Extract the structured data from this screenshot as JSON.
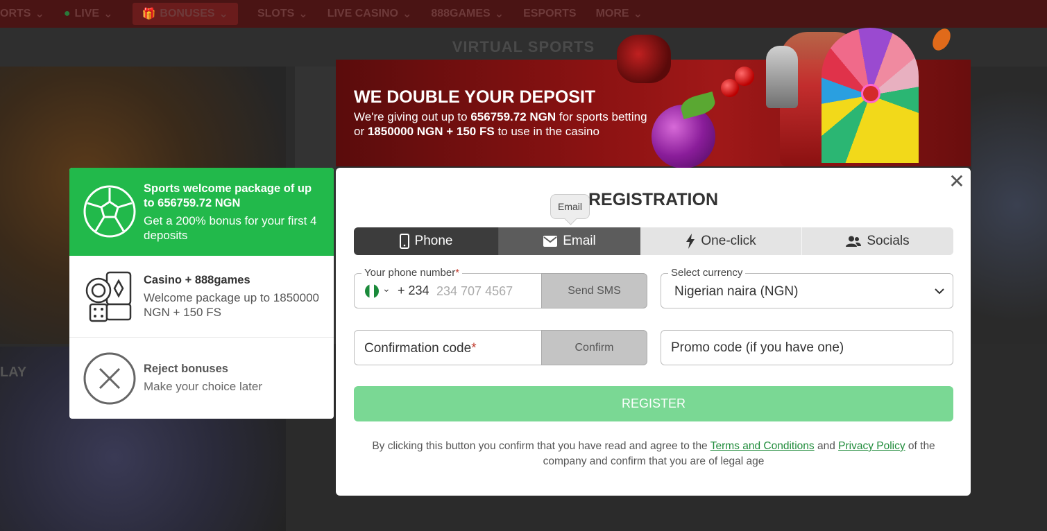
{
  "topnav": {
    "items": [
      "ORTS",
      "LIVE",
      "BONUSES",
      "SLOTS",
      "LIVE CASINO",
      "888GAMES",
      "ESPORTS",
      "MORE"
    ]
  },
  "subbar": {
    "title": "VIRTUAL SPORTS"
  },
  "background": {
    "left_label": "LAY"
  },
  "banner": {
    "title": "WE DOUBLE YOUR DEPOSIT",
    "line1_pre": "We're giving out up to ",
    "line1_bold": "656759.72 NGN",
    "line1_post": " for sports betting",
    "line2_pre": "or ",
    "line2_bold": "1850000 NGN + 150 FS",
    "line2_post": " to use in the casino"
  },
  "bonuses": {
    "sports": {
      "title": "Sports welcome package of up to 656759.72 NGN",
      "desc": "Get a 200% bonus for your first 4 deposits",
      "icon": "soccer-ball-icon"
    },
    "casino": {
      "title": "Casino + 888games",
      "desc": "Welcome package up to 1850000 NGN + 150 FS",
      "icon": "casino-chips-icon"
    },
    "reject": {
      "title": "Reject bonuses",
      "desc": "Make your choice later",
      "icon": "close-circle-icon"
    }
  },
  "modal": {
    "title": "REGISTRATION",
    "tooltip": "Email",
    "tabs": [
      {
        "label": "Phone",
        "icon": "phone-icon"
      },
      {
        "label": "Email",
        "icon": "mail-icon"
      },
      {
        "label": "One-click",
        "icon": "lightning-icon"
      },
      {
        "label": "Socials",
        "icon": "users-icon"
      }
    ],
    "phone": {
      "label": "Your phone number",
      "required_mark": "*",
      "dial_code": "+ 234",
      "placeholder": "234 707 4567",
      "send_label": "Send SMS"
    },
    "currency": {
      "label": "Select currency",
      "value": "Nigerian naira (NGN)"
    },
    "confirmation": {
      "label": "Confirmation code",
      "required_mark": "*",
      "confirm_label": "Confirm"
    },
    "promo": {
      "placeholder": "Promo code (if you have one)"
    },
    "register_label": "REGISTER",
    "legal": {
      "pre": "By clicking this button you confirm that you have read and agree to the ",
      "terms": "Terms and Conditions",
      "and": " and ",
      "privacy": "Privacy Policy",
      "post": " of the company and confirm that you are of legal age"
    }
  },
  "colors": {
    "accent_green": "#22b94b",
    "register_green": "#7ad894",
    "link_green": "#1f8b3a",
    "banner_red": "#8a1212"
  }
}
